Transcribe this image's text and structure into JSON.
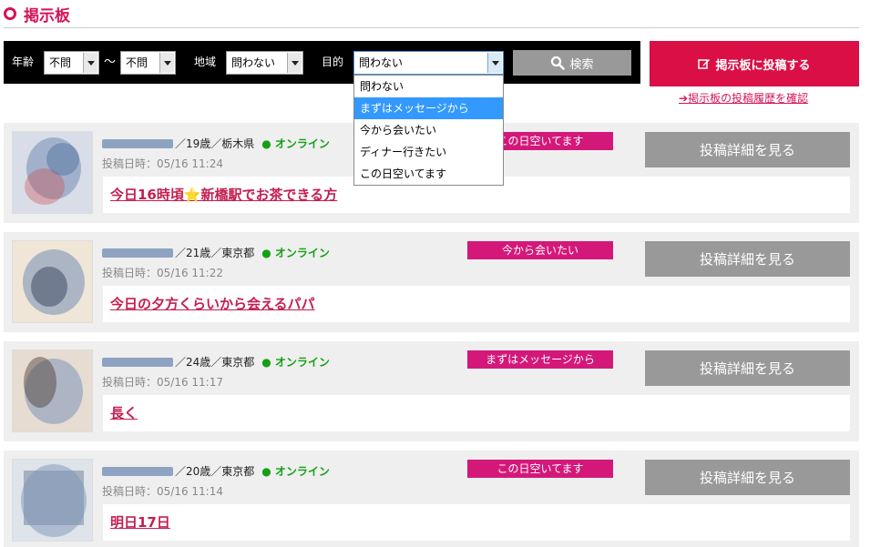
{
  "page": {
    "title": "掲示板"
  },
  "filter": {
    "age_label": "年齢",
    "age_from": "不問",
    "tilde": "～",
    "age_to": "不問",
    "region_label": "地域",
    "region_value": "問わない",
    "purpose_label": "目的",
    "purpose_value": "問わない",
    "search_label": "検索"
  },
  "dropdown": {
    "options": [
      "問わない",
      "まずはメッセージから",
      "今から会いたい",
      "ディナー行きたい",
      "この日空いてます"
    ],
    "highlighted_index": 1
  },
  "post_button": {
    "label": "掲示板に投稿する"
  },
  "history_link": {
    "label": "掲示板の投稿履歴を確認"
  },
  "posts": [
    {
      "age_region": "／19歳／栃木県",
      "status": "● オンライン",
      "date": "投稿日時：05/16 11:24",
      "tag": "この日空いてます",
      "detail": "投稿詳細を見る",
      "message": "今日16時頃⭐新橋駅でお茶できる方"
    },
    {
      "age_region": "／21歳／東京都",
      "status": "● オンライン",
      "date": "投稿日時：05/16 11:22",
      "tag": "今から会いたい",
      "detail": "投稿詳細を見る",
      "message": "今日の夕方くらいから会えるパパ"
    },
    {
      "age_region": "／24歳／東京都",
      "status": "● オンライン",
      "date": "投稿日時：05/16 11:17",
      "tag": "まずはメッセージから",
      "detail": "投稿詳細を見る",
      "message": "長く"
    },
    {
      "age_region": "／20歳／東京都",
      "status": "● オンライン",
      "date": "投稿日時：05/16 11:14",
      "tag": "この日空いてます",
      "detail": "投稿詳細を見る",
      "message": "明日17日"
    }
  ],
  "colors": {
    "accent": "#d90f45",
    "tag": "#d4187a",
    "online": "#14a014",
    "button_gray": "#999999"
  }
}
